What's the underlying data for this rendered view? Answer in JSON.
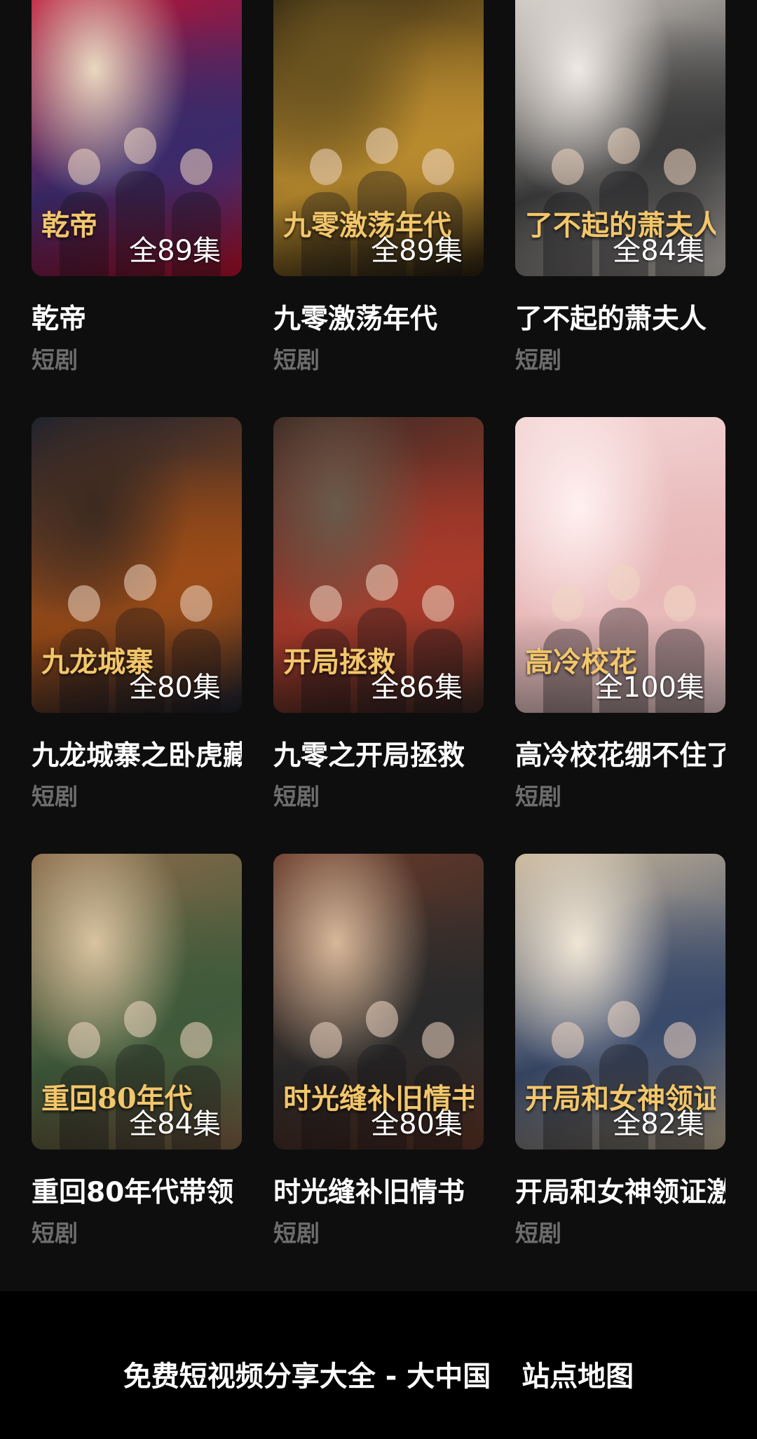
{
  "cards": [
    {
      "title": "乾帝",
      "genre": "短剧",
      "episodes": "全89集",
      "poster_text": "乾帝",
      "colors": [
        "#c8102e",
        "#3a2a6a",
        "#e9d8c0"
      ]
    },
    {
      "title": "九零激荡年代",
      "genre": "短剧",
      "episodes": "全89集",
      "poster_text": "九零激荡年代",
      "colors": [
        "#2a2110",
        "#b88a2e",
        "#6b5420"
      ]
    },
    {
      "title": "了不起的萧夫人",
      "genre": "短剧",
      "episodes": "全84集",
      "poster_text": "了不起的萧夫人",
      "colors": [
        "#d9d2cc",
        "#3b3b3b",
        "#efe9e4"
      ]
    },
    {
      "title": "九龙城寨之卧虎藏龙",
      "genre": "短剧",
      "episodes": "全80集",
      "poster_text": "九龙城寨",
      "colors": [
        "#1c2230",
        "#9a4b17",
        "#3c2a20"
      ]
    },
    {
      "title": "九零之开局拯救",
      "genre": "短剧",
      "episodes": "全86集",
      "poster_text": "开局拯救",
      "colors": [
        "#3b2a24",
        "#a83a2a",
        "#6a5a4a"
      ]
    },
    {
      "title": "高冷校花绷不住了",
      "genre": "短剧",
      "episodes": "全100集",
      "poster_text": "高冷校花",
      "colors": [
        "#f4d6d6",
        "#e8b8b8",
        "#fff0f0"
      ]
    },
    {
      "title": "重回80年代带领",
      "genre": "短剧",
      "episodes": "全84集",
      "poster_text": "重回80年代",
      "colors": [
        "#8a6a4a",
        "#3f5a3a",
        "#d9c3a0"
      ]
    },
    {
      "title": "时光缝补旧情书",
      "genre": "短剧",
      "episodes": "全80集",
      "poster_text": "时光缝补旧情书",
      "colors": [
        "#6a3a2a",
        "#2a2a2a",
        "#d8b89a"
      ]
    },
    {
      "title": "开局和女神领证激活",
      "genre": "短剧",
      "episodes": "全82集",
      "poster_text": "开局和女神领证",
      "colors": [
        "#c9b79a",
        "#3a4a6a",
        "#f0e6d6"
      ]
    }
  ],
  "footer": {
    "site_text": "免费短视频分享大全 - 大中国",
    "sitemap_label": "站点地图"
  }
}
